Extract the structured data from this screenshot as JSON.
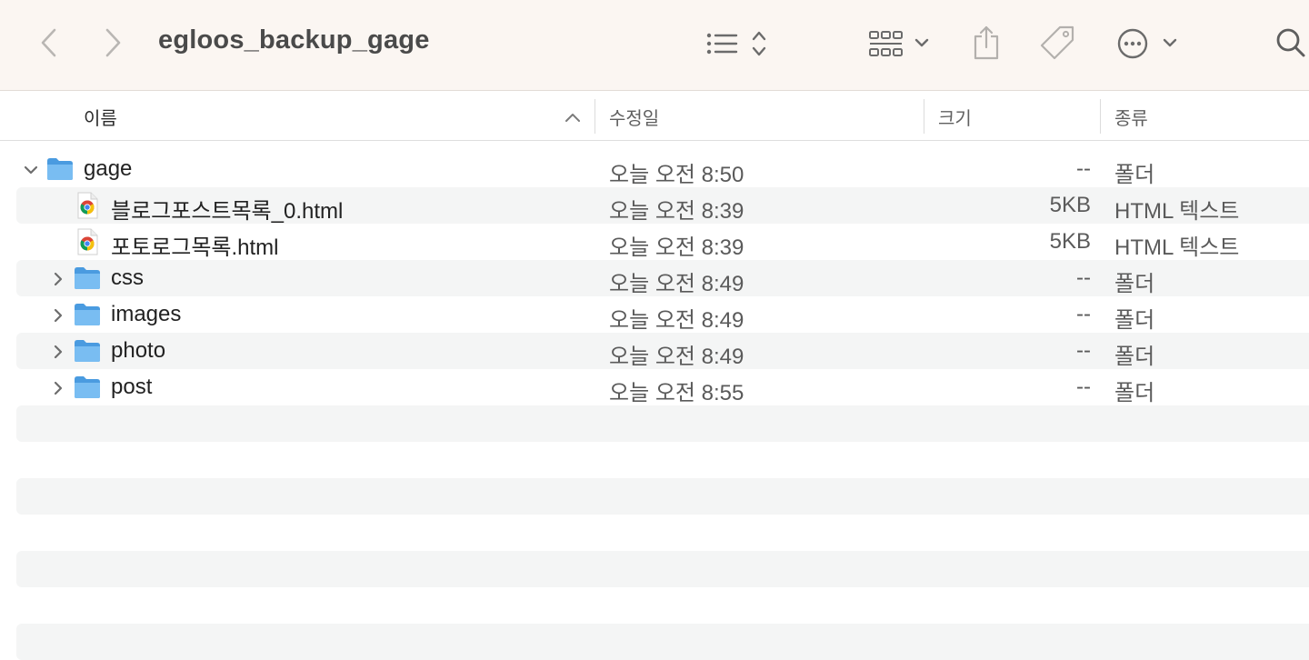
{
  "window": {
    "title": "egloos_backup_gage"
  },
  "toolbar": {
    "back_icon": "chevron-left-icon",
    "forward_icon": "chevron-right-icon",
    "view_list_icon": "list-view-icon",
    "group_icon": "grid-group-icon",
    "share_icon": "share-icon",
    "tag_icon": "tag-icon",
    "more_icon": "ellipsis-circle-icon",
    "search_icon": "search-icon"
  },
  "columns": {
    "name": "이름",
    "modified": "수정일",
    "size": "크기",
    "kind": "종류"
  },
  "files": [
    {
      "name": "gage",
      "date": "오늘 오전 8:50",
      "size": "--",
      "kind": "폴더",
      "type": "folder",
      "level": 0,
      "expanded": true
    },
    {
      "name": "블로그포스트목록_0.html",
      "date": "오늘 오전 8:39",
      "size": "5KB",
      "kind": "HTML 텍스트",
      "type": "html",
      "level": 1,
      "expanded": false
    },
    {
      "name": "포토로그목록.html",
      "date": "오늘 오전 8:39",
      "size": "5KB",
      "kind": "HTML 텍스트",
      "type": "html",
      "level": 1,
      "expanded": false
    },
    {
      "name": "css",
      "date": "오늘 오전 8:49",
      "size": "--",
      "kind": "폴더",
      "type": "folder",
      "level": 1,
      "expanded": false
    },
    {
      "name": "images",
      "date": "오늘 오전 8:49",
      "size": "--",
      "kind": "폴더",
      "type": "folder",
      "level": 1,
      "expanded": false
    },
    {
      "name": "photo",
      "date": "오늘 오전 8:49",
      "size": "--",
      "kind": "폴더",
      "type": "folder",
      "level": 1,
      "expanded": false
    },
    {
      "name": "post",
      "date": "오늘 오전 8:55",
      "size": "--",
      "kind": "폴더",
      "type": "folder",
      "level": 1,
      "expanded": false
    }
  ],
  "colors": {
    "toolbar_bg": "#fbf6f2",
    "stripe": "#f4f5f5",
    "folder": "#5aa9e6"
  }
}
